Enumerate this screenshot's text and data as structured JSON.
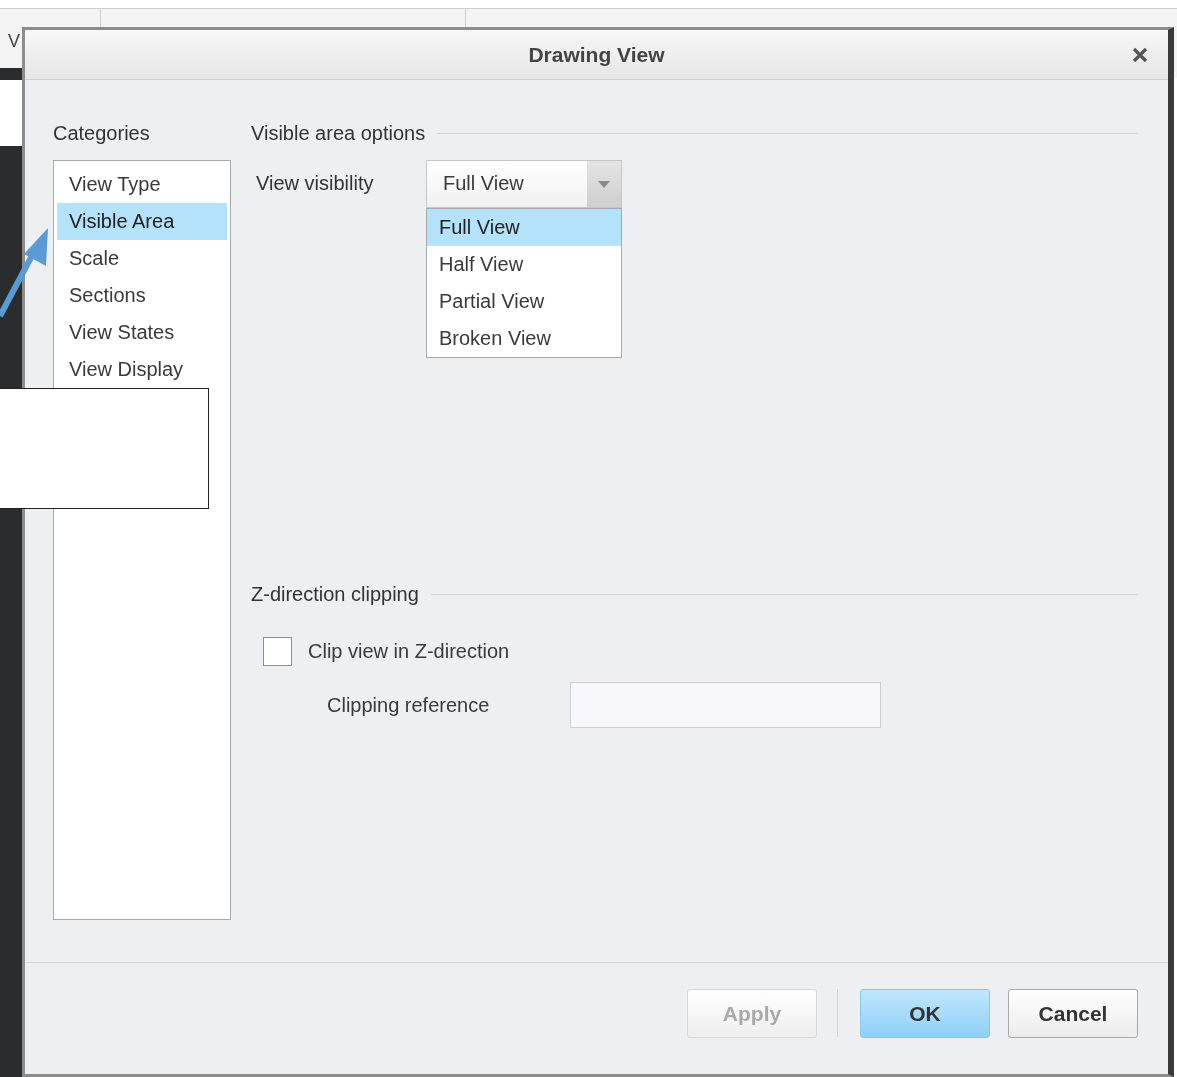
{
  "background": {
    "text": "V"
  },
  "dialog": {
    "title": "Drawing View"
  },
  "categories": {
    "label": "Categories",
    "items": [
      {
        "label": "View Type",
        "selected": false
      },
      {
        "label": "Visible Area",
        "selected": true
      },
      {
        "label": "Scale",
        "selected": false
      },
      {
        "label": "Sections",
        "selected": false
      },
      {
        "label": "View States",
        "selected": false
      },
      {
        "label": "View Display",
        "selected": false
      }
    ]
  },
  "visible_area": {
    "heading": "Visible area options",
    "view_visibility": {
      "label": "View visibility",
      "value": "Full View",
      "expanded": true,
      "options": [
        {
          "label": "Full View",
          "selected": true
        },
        {
          "label": "Half View",
          "selected": false
        },
        {
          "label": "Partial View",
          "selected": false
        },
        {
          "label": "Broken View",
          "selected": false
        }
      ]
    }
  },
  "z_clipping": {
    "heading": "Z-direction clipping",
    "checkbox": {
      "label": "Clip view in Z-direction",
      "checked": false
    },
    "reference": {
      "label": "Clipping reference"
    }
  },
  "buttons": [
    {
      "label": "Apply",
      "kind": "secondary",
      "disabled": true
    },
    {
      "label": "OK",
      "kind": "primary",
      "disabled": false
    },
    {
      "label": "Cancel",
      "kind": "secondary",
      "disabled": false
    }
  ]
}
